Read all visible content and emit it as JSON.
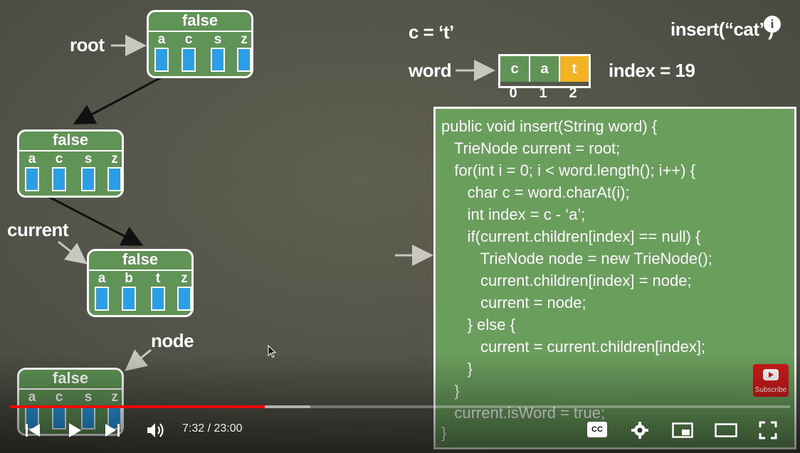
{
  "video": {
    "title_text": "insert(“cat”)",
    "c_assignment": "c = ‘t’",
    "index_assignment": "index = 19",
    "labels": {
      "root": "root",
      "word": "word",
      "current": "current",
      "node": "node"
    },
    "word_chars": [
      "c",
      "a",
      "t"
    ],
    "word_indices": [
      "0",
      "1",
      "2"
    ],
    "trie_nodes": [
      {
        "header": "false",
        "letters": [
          "a",
          "c",
          "s",
          "z"
        ]
      },
      {
        "header": "false",
        "letters": [
          "a",
          "c",
          "s",
          "z"
        ]
      },
      {
        "header": "false",
        "letters": [
          "a",
          "b",
          "t",
          "z"
        ]
      },
      {
        "header": "false",
        "letters": [
          "a",
          "c",
          "s",
          "z"
        ]
      }
    ],
    "code_lines": [
      "public void insert(String word) {",
      "   TrieNode current = root;",
      "   for(int i = 0; i < word.length(); i++) {",
      "      char c = word.charAt(i);",
      "      int index = c - ‘a’;",
      "      if(current.children[index] == null) {",
      "         TrieNode node = new TrieNode();",
      "         current.children[index] = node;",
      "         current = node;",
      "      } else {",
      "         current = current.children[index];",
      "      }",
      "   }",
      "   current.isWord = true;",
      "}"
    ],
    "subscribe_label": "Subscribe",
    "info_label": "i"
  },
  "player": {
    "time_display": "7:32 / 23:00",
    "progress_fraction": 0.327,
    "buffered_fraction": 0.385,
    "cc_label": "CC",
    "accent_color": "#ff0000"
  }
}
